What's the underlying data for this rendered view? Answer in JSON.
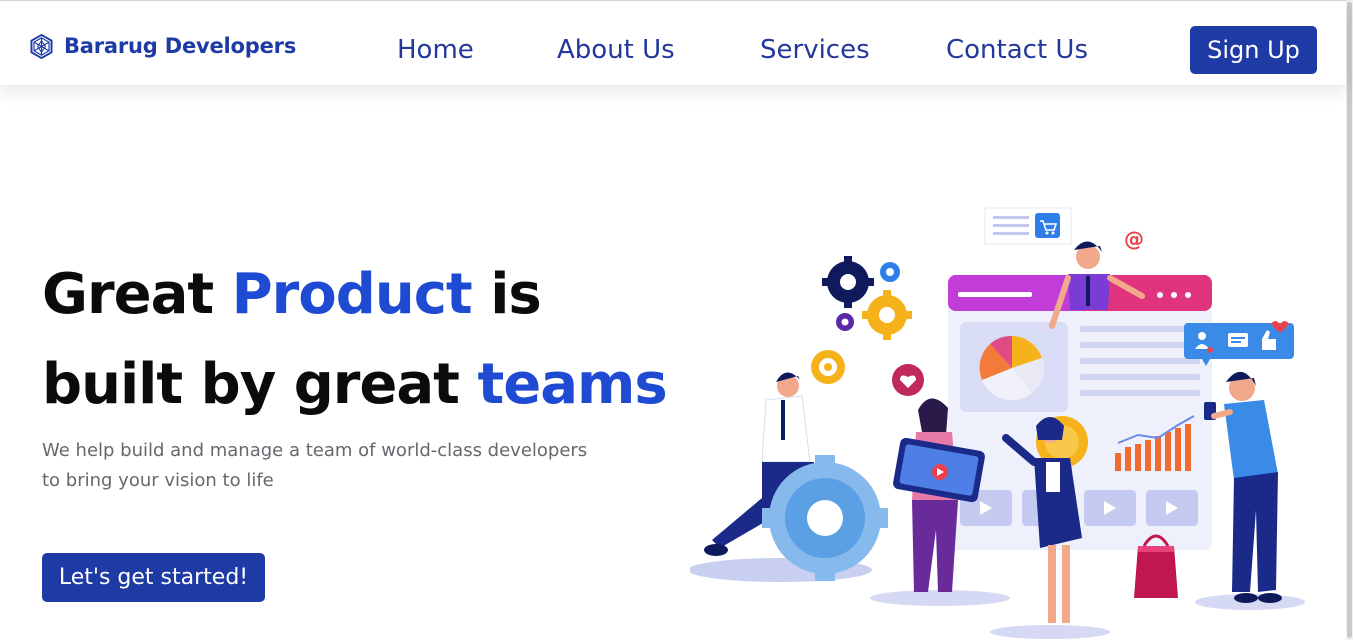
{
  "nav": {
    "brand": "Bararug Developers",
    "brand_icon": "hexagon-mesh-icon",
    "links": [
      "Home",
      "About Us",
      "Services",
      "Contact Us"
    ],
    "signup_label": "Sign Up"
  },
  "hero": {
    "title_line1": {
      "w1": "Great",
      "w2": "Product",
      "w3": "is"
    },
    "title_line2": {
      "w1": "built by great",
      "w2": "teams"
    },
    "subtitle_line1": "We help build and manage a team of world-class developers",
    "subtitle_line2": "to bring your vision to life",
    "cta_label": "Let's get started!",
    "illustration": "team-building-product-illustration"
  },
  "colors": {
    "brand": "#1e3aa5",
    "accent": "#1e4bd2",
    "text": "#0b0b0b",
    "muted": "#66686d"
  }
}
